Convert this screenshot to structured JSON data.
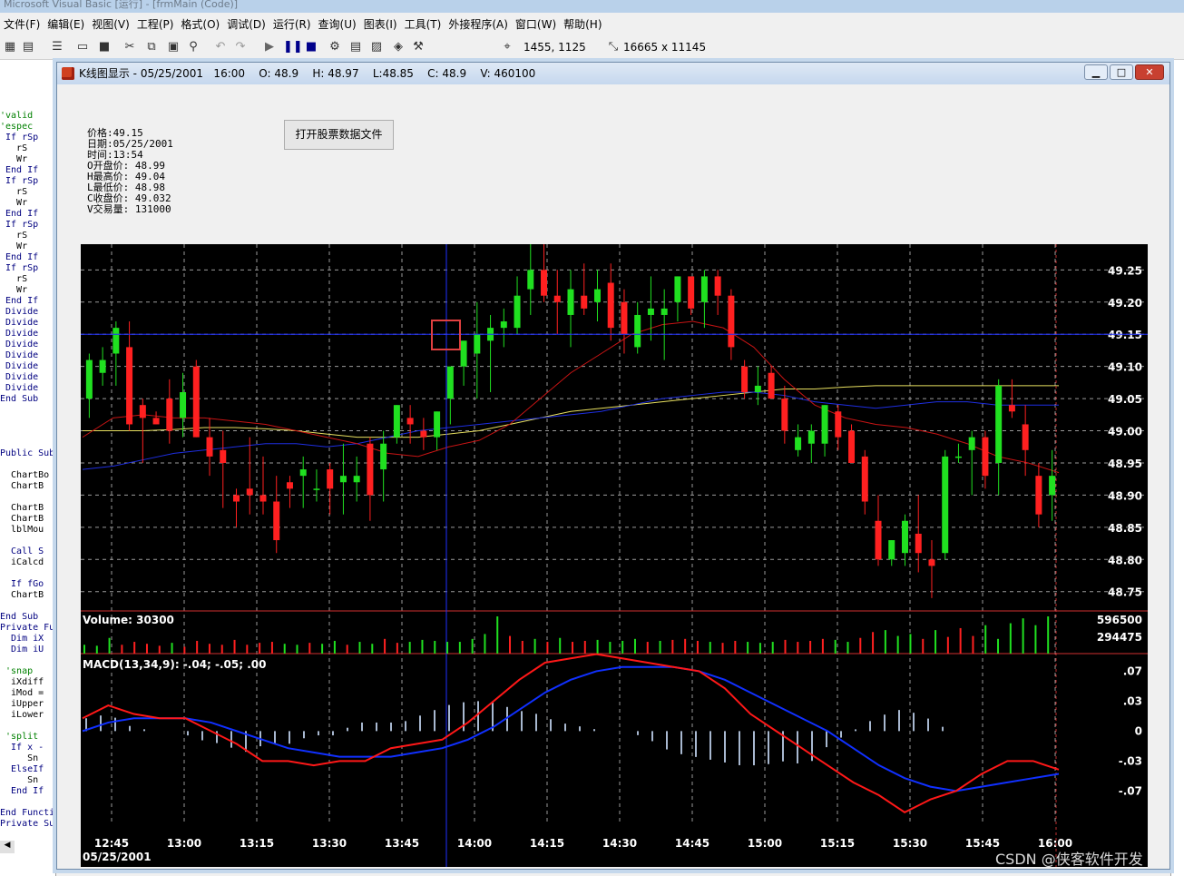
{
  "ide": {
    "title": "Microsoft Visual Basic [运行] - [frmMain (Code)]",
    "menu": [
      "文件(F)",
      "编辑(E)",
      "视图(V)",
      "工程(P)",
      "格式(O)",
      "调试(D)",
      "运行(R)",
      "查询(U)",
      "图表(I)",
      "工具(T)",
      "外接程序(A)",
      "窗口(W)",
      "帮助(H)"
    ],
    "position": "1455, 1125",
    "size": "16665 x 11145"
  },
  "code_lines": [
    "'valid",
    "'espec",
    " If rSp",
    "   rS",
    "   Wr",
    " End If",
    " If rSp",
    "   rS",
    "   Wr",
    " End If",
    " If rSp",
    "   rS",
    "   Wr",
    " End If",
    " If rSp",
    "   rS",
    "   Wr",
    " End If",
    " Divide",
    " Divide",
    " Divide",
    " Divide",
    " Divide",
    " Divide",
    " Divide",
    " Divide",
    "End Sub",
    "",
    "",
    "",
    "",
    "Public Sub",
    "",
    "  ChartBo",
    "  ChartB",
    "",
    "  ChartB",
    "  ChartB",
    "  lblMou",
    "",
    "  Call S",
    "  iCalcd",
    "",
    "  If fGo",
    "  ChartB",
    "",
    "End Sub",
    "Private Fu",
    "  Dim iX",
    "  Dim iU",
    "",
    " 'snap",
    "  iXdiff",
    "  iMod =",
    "  iUpper",
    "  iLower",
    "",
    " 'split",
    "  If x -",
    "     Sn",
    "  ElseIf",
    "     Sn",
    "  End If",
    "",
    "End Functi",
    "Private Su"
  ],
  "window": {
    "title": "K线图显示 - 05/25/2001   16:00    O: 48.9    H: 48.97    L:48.85    C: 48.9    V: 460100",
    "min": "▁",
    "max": "□",
    "close": "✕"
  },
  "info": {
    "lines": [
      "价格:49.15",
      "日期:05/25/2001",
      "时间:13:54",
      "O开盘价: 48.99",
      "H最高价: 49.04",
      "L最低价: 48.98",
      "C收盘价: 49.032",
      "V交易量: 131000"
    ]
  },
  "open_button": "打开股票数据文件",
  "chart_data": {
    "type": "candlestick",
    "date": "05/25/2001",
    "x_ticks": [
      "12:45",
      "13:00",
      "13:15",
      "13:30",
      "13:45",
      "14:00",
      "14:15",
      "14:30",
      "14:45",
      "15:00",
      "15:15",
      "15:30",
      "15:45",
      "16:00"
    ],
    "price_ticks": [
      "49.25",
      "49.20",
      "49.15",
      "49.10",
      "49.05",
      "49.00",
      "48.95",
      "48.90",
      "48.85",
      "48.80",
      "48.75"
    ],
    "price_range": [
      48.72,
      49.29
    ],
    "crosshair_price": 49.15,
    "volume_label": "Volume: 30300",
    "volume_ticks": [
      "596500",
      "294475"
    ],
    "macd_label": "MACD(13,34,9): -.04; -.05; .00",
    "macd_ticks": [
      ".07",
      ".03",
      "0",
      "-.03",
      "-.07"
    ],
    "candles": [
      [
        49.05,
        49.12,
        49.02,
        49.11
      ],
      [
        49.09,
        49.13,
        49.07,
        49.11
      ],
      [
        49.12,
        49.17,
        49.07,
        49.16
      ],
      [
        49.13,
        49.17,
        49.0,
        49.01
      ],
      [
        49.04,
        49.05,
        48.95,
        49.02
      ],
      [
        49.02,
        49.03,
        49.01,
        49.01
      ],
      [
        49.05,
        49.08,
        48.98,
        49.0
      ],
      [
        49.02,
        49.09,
        48.99,
        49.06
      ],
      [
        49.1,
        49.11,
        48.99,
        48.99
      ],
      [
        48.99,
        49.02,
        48.93,
        48.96
      ],
      [
        48.97,
        49.0,
        48.88,
        48.95
      ],
      [
        48.9,
        48.91,
        48.85,
        48.89
      ],
      [
        48.91,
        48.99,
        48.87,
        48.9
      ],
      [
        48.9,
        48.96,
        48.87,
        48.89
      ],
      [
        48.89,
        48.93,
        48.81,
        48.83
      ],
      [
        48.92,
        48.93,
        48.88,
        48.91
      ],
      [
        48.93,
        48.96,
        48.88,
        48.94
      ],
      [
        48.91,
        48.94,
        48.89,
        48.91
      ],
      [
        48.94,
        48.95,
        48.87,
        48.91
      ],
      [
        48.92,
        48.98,
        48.87,
        48.93
      ],
      [
        48.92,
        48.96,
        48.89,
        48.93
      ],
      [
        48.98,
        48.99,
        48.86,
        48.9
      ],
      [
        48.94,
        49.0,
        48.89,
        48.98
      ],
      [
        48.99,
        49.04,
        48.98,
        49.04
      ],
      [
        49.02,
        49.04,
        48.98,
        49.01
      ],
      [
        49.0,
        49.02,
        48.97,
        48.99
      ],
      [
        48.99,
        49.03,
        48.97,
        49.03
      ],
      [
        49.05,
        49.1,
        49.01,
        49.1
      ],
      [
        49.1,
        49.14,
        49.07,
        49.14
      ],
      [
        49.12,
        49.2,
        49.05,
        49.15
      ],
      [
        49.14,
        49.18,
        49.06,
        49.16
      ],
      [
        49.16,
        49.19,
        49.13,
        49.17
      ],
      [
        49.16,
        49.24,
        49.15,
        49.21
      ],
      [
        49.22,
        49.29,
        49.18,
        49.25
      ],
      [
        49.25,
        49.29,
        49.2,
        49.21
      ],
      [
        49.21,
        49.25,
        49.15,
        49.2
      ],
      [
        49.18,
        49.25,
        49.13,
        49.22
      ],
      [
        49.21,
        49.26,
        49.18,
        49.19
      ],
      [
        49.2,
        49.25,
        49.17,
        49.22
      ],
      [
        49.23,
        49.26,
        49.14,
        49.16
      ],
      [
        49.2,
        49.22,
        49.12,
        49.15
      ],
      [
        49.13,
        49.2,
        49.12,
        49.18
      ],
      [
        49.18,
        49.24,
        49.14,
        49.19
      ],
      [
        49.18,
        49.22,
        49.11,
        49.19
      ],
      [
        49.2,
        49.24,
        49.17,
        49.24
      ],
      [
        49.24,
        49.24,
        49.18,
        49.19
      ],
      [
        49.2,
        49.25,
        49.16,
        49.24
      ],
      [
        49.24,
        49.25,
        49.18,
        49.21
      ],
      [
        49.21,
        49.22,
        49.11,
        49.13
      ],
      [
        49.1,
        49.11,
        49.05,
        49.06
      ],
      [
        49.06,
        49.1,
        49.04,
        49.07
      ],
      [
        49.09,
        49.1,
        49.05,
        49.05
      ],
      [
        49.05,
        49.07,
        48.98,
        49.0
      ],
      [
        48.97,
        49.01,
        48.96,
        48.99
      ],
      [
        48.98,
        49.01,
        48.95,
        49.0
      ],
      [
        48.98,
        49.04,
        48.96,
        49.04
      ],
      [
        49.03,
        49.04,
        48.97,
        48.99
      ],
      [
        49.0,
        49.01,
        48.95,
        48.95
      ],
      [
        48.96,
        48.97,
        48.87,
        48.89
      ],
      [
        48.86,
        48.9,
        48.79,
        48.8
      ],
      [
        48.8,
        48.83,
        48.79,
        48.83
      ],
      [
        48.81,
        48.87,
        48.79,
        48.86
      ],
      [
        48.84,
        48.9,
        48.78,
        48.81
      ],
      [
        48.8,
        48.83,
        48.74,
        48.79
      ],
      [
        48.81,
        48.97,
        48.8,
        48.96
      ],
      [
        48.96,
        48.98,
        48.95,
        48.96
      ],
      [
        48.97,
        49.0,
        48.9,
        48.99
      ],
      [
        48.99,
        49.0,
        48.91,
        48.93
      ],
      [
        48.95,
        49.08,
        48.9,
        49.07
      ],
      [
        49.04,
        49.08,
        49.02,
        49.03
      ],
      [
        49.01,
        49.04,
        48.93,
        48.97
      ],
      [
        48.93,
        48.95,
        48.85,
        48.87
      ],
      [
        48.9,
        48.97,
        48.86,
        48.93
      ]
    ],
    "volumes": [
      9,
      8,
      16,
      9,
      12,
      10,
      8,
      11,
      7,
      13,
      10,
      9,
      14,
      9,
      11,
      12,
      10,
      9,
      11,
      10,
      13,
      9,
      12,
      10,
      15,
      11,
      12,
      14,
      13,
      12,
      12,
      15,
      20,
      38,
      18,
      13,
      15,
      12,
      16,
      12,
      13,
      14,
      12,
      13,
      15,
      12,
      13,
      14,
      15,
      13,
      12,
      11,
      13,
      12,
      11,
      12,
      14,
      12,
      13,
      15,
      14,
      12,
      16,
      22,
      24,
      18,
      20,
      15,
      24,
      17,
      26,
      18,
      29,
      15,
      31,
      36,
      29,
      38
    ],
    "ma_red": [
      48.99,
      49.02,
      49.025,
      49.02,
      49.02,
      49.015,
      49.01,
      49.0,
      48.99,
      48.98,
      48.965,
      48.96,
      48.975,
      48.985,
      49.01,
      49.05,
      49.09,
      49.12,
      49.15,
      49.165,
      49.17,
      49.16,
      49.13,
      49.08,
      49.04,
      49.02,
      49.01,
      49.005,
      48.995,
      48.98,
      48.96,
      48.95,
      48.935
    ],
    "ma_blue": [
      48.94,
      48.945,
      48.955,
      48.965,
      48.97,
      48.975,
      48.98,
      48.98,
      48.975,
      48.98,
      48.99,
      49.0,
      49.005,
      49.01,
      49.015,
      49.02,
      49.025,
      49.03,
      49.04,
      49.05,
      49.055,
      49.06,
      49.06,
      49.055,
      49.045,
      49.04,
      49.035,
      49.04,
      49.045,
      49.045,
      49.04,
      49.04,
      49.04
    ],
    "ma_yellow": [
      49.0,
      49.0,
      49.0,
      49.002,
      49.005,
      49.005,
      49.003,
      49.0,
      48.995,
      48.99,
      48.99,
      48.99,
      48.995,
      49.0,
      49.01,
      49.02,
      49.03,
      49.035,
      49.04,
      49.045,
      49.05,
      49.055,
      49.06,
      49.065,
      49.065,
      49.068,
      49.07,
      49.07,
      49.07,
      49.07,
      49.07,
      49.07,
      49.07
    ],
    "macd_red": [
      0.015,
      0.03,
      0.02,
      0.015,
      0.015,
      0.0,
      -0.015,
      -0.035,
      -0.035,
      -0.04,
      -0.035,
      -0.035,
      -0.02,
      -0.015,
      -0.01,
      0.01,
      0.035,
      0.06,
      0.08,
      0.085,
      0.09,
      0.085,
      0.08,
      0.075,
      0.07,
      0.05,
      0.02,
      0.0,
      -0.02,
      -0.04,
      -0.06,
      -0.075,
      -0.095,
      -0.08,
      -0.07,
      -0.05,
      -0.035,
      -0.035,
      -0.045
    ],
    "macd_blue": [
      0.0,
      0.01,
      0.015,
      0.015,
      0.015,
      0.01,
      0.0,
      -0.01,
      -0.02,
      -0.025,
      -0.03,
      -0.03,
      -0.03,
      -0.025,
      -0.02,
      -0.01,
      0.005,
      0.025,
      0.045,
      0.06,
      0.07,
      0.075,
      0.075,
      0.075,
      0.07,
      0.06,
      0.045,
      0.03,
      0.015,
      0.0,
      -0.02,
      -0.04,
      -0.055,
      -0.065,
      -0.07,
      -0.065,
      -0.06,
      -0.055,
      -0.05
    ],
    "colors": {
      "up": "#20e020",
      "down": "#ff2020",
      "ma_red": "#c81414",
      "ma_blue": "#1e2ee0",
      "ma_yellow": "#e8e060",
      "grid": "#9a9a9a",
      "crosshair": "#2030ff"
    }
  },
  "watermark": "CSDN @侠客软件开发"
}
